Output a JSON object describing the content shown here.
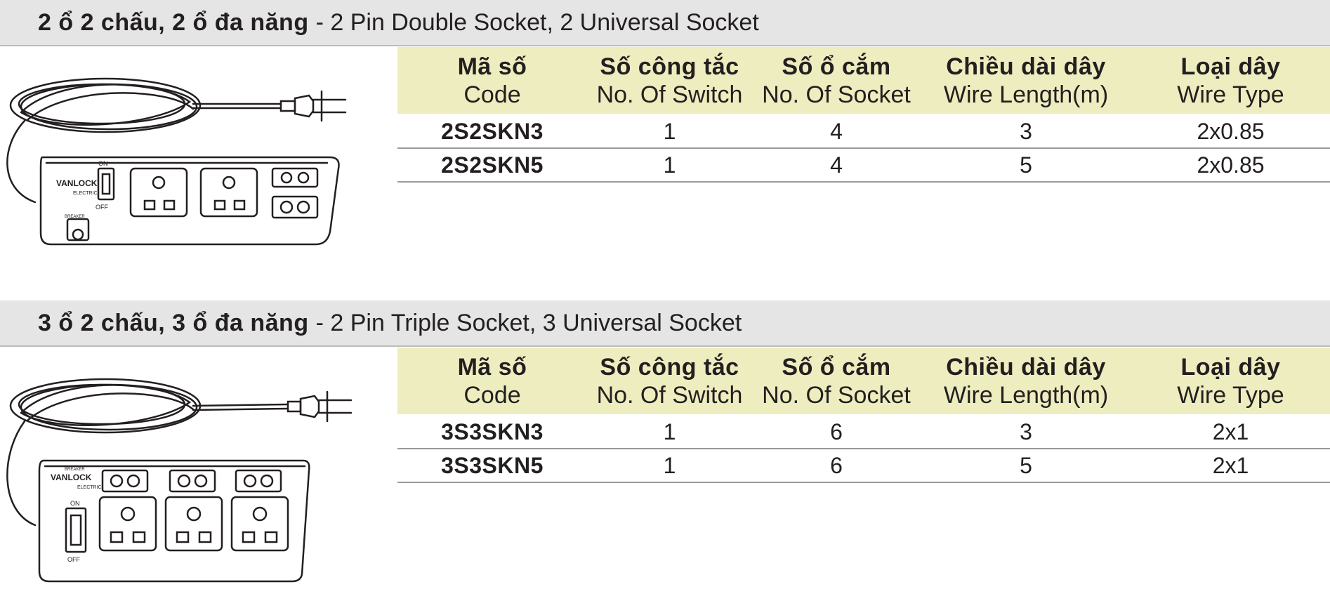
{
  "sections": [
    {
      "title_vi": "2 ổ 2 chấu, 2 ổ đa năng",
      "title_en": "- 2 Pin Double Socket, 2 Universal Socket",
      "headers": [
        {
          "vi": "Mã số",
          "en": "Code"
        },
        {
          "vi": "Số công tắc",
          "en": "No. Of Switch"
        },
        {
          "vi": "Số ổ cắm",
          "en": "No. Of Socket"
        },
        {
          "vi": "Chiều dài dây",
          "en": "Wire Length(m)"
        },
        {
          "vi": "Loại dây",
          "en": "Wire Type"
        }
      ],
      "rows": [
        {
          "code": "2S2SKN3",
          "switches": "1",
          "sockets": "4",
          "length": "3",
          "wire": "2x0.85"
        },
        {
          "code": "2S2SKN5",
          "switches": "1",
          "sockets": "4",
          "length": "5",
          "wire": "2x0.85"
        }
      ],
      "image": {
        "icon": "power-strip-icon",
        "brand": "VANLOCK",
        "brand_sub": "ELECTRIC",
        "label_on": "ON",
        "label_off": "OFF",
        "label_breaker": "BREAKER"
      }
    },
    {
      "title_vi": "3 ổ 2 chấu, 3 ổ đa năng",
      "title_en": "- 2 Pin Triple Socket, 3 Universal Socket",
      "headers": [
        {
          "vi": "Mã số",
          "en": "Code"
        },
        {
          "vi": "Số công tắc",
          "en": "No. Of Switch"
        },
        {
          "vi": "Số ổ cắm",
          "en": "No. Of Socket"
        },
        {
          "vi": "Chiều dài dây",
          "en": "Wire Length(m)"
        },
        {
          "vi": "Loại dây",
          "en": "Wire Type"
        }
      ],
      "rows": [
        {
          "code": "3S3SKN3",
          "switches": "1",
          "sockets": "6",
          "length": "3",
          "wire": "2x1"
        },
        {
          "code": "3S3SKN5",
          "switches": "1",
          "sockets": "6",
          "length": "5",
          "wire": "2x1"
        }
      ],
      "image": {
        "icon": "power-strip-icon",
        "brand": "VANLOCK",
        "brand_sub": "ELECTRIC",
        "label_on": "ON",
        "label_off": "OFF",
        "label_breaker": "BREAKER"
      }
    }
  ],
  "colors": {
    "header_bg": "#eeedbf",
    "title_bar_bg": "#e5e5e5",
    "text": "#231f20",
    "rule": "#9a9a9a"
  }
}
